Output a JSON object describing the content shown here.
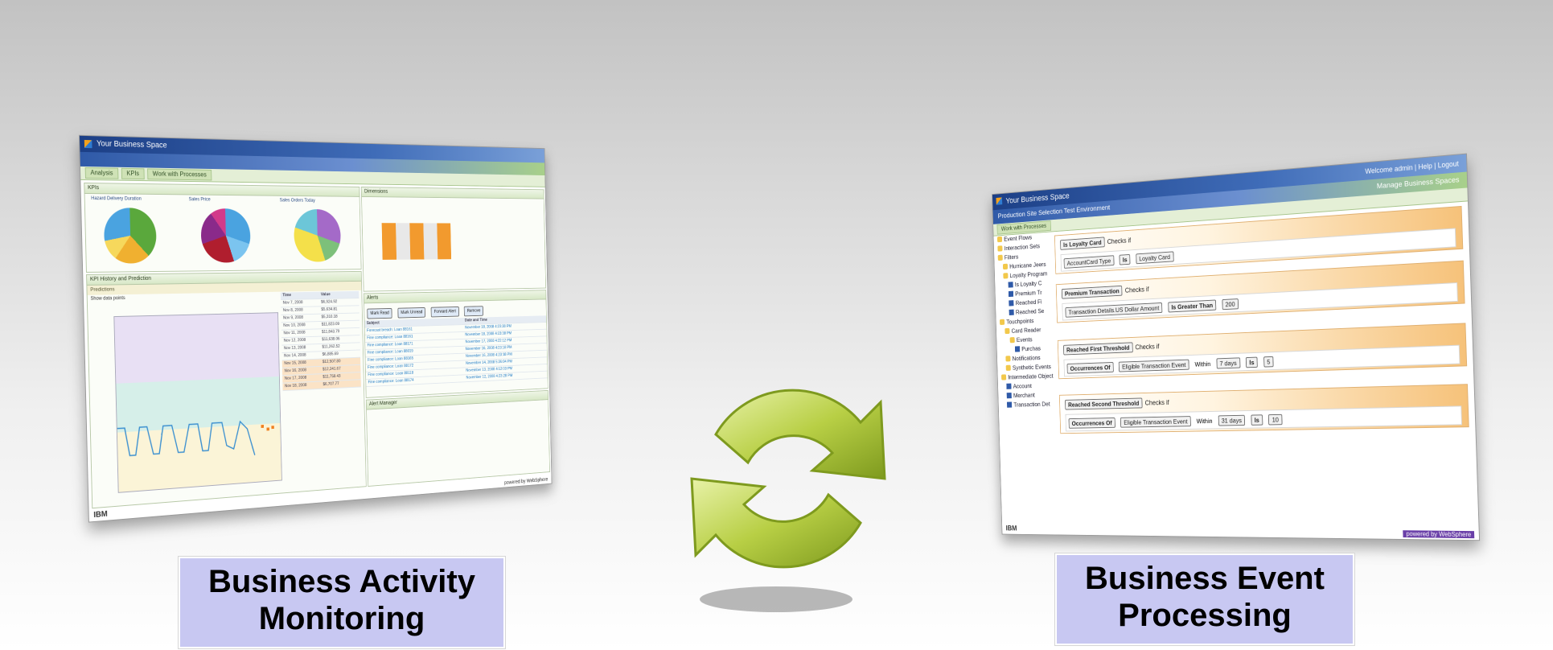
{
  "captions": {
    "bam_line1": "Business Activity",
    "bam_line2": "Monitoring",
    "bep_line1": "Business Event",
    "bep_line2": "Processing"
  },
  "left_screen": {
    "app_title": "Your Business Space",
    "tabs": [
      "Analysis",
      "KPIs",
      "Work with Processes"
    ],
    "kpi_panel_title": "KPIs",
    "pie_titles": [
      "Hazard Delivery Duration",
      "Sales Price",
      "Sales Orders Today"
    ],
    "kpi_history_title": "KPI History and Prediction",
    "kpi_history_tab": "Predictions",
    "show_data_points_label": "Show data points",
    "y_axis_values": [
      "$20,000",
      "$19,000",
      "$18,000",
      "$17,000",
      "$16,000",
      "$15,000",
      "$14,000",
      "$13,000",
      "$12,000",
      "$11,000",
      "$10,000",
      "$9,000",
      "$8,000",
      "$7,000",
      "$6,000",
      "$5,000"
    ],
    "x_axis_values": [
      "Nov 1, 2008",
      "Nov 7, 2008",
      "Nov 14, 2008",
      "Nov 21, 2008",
      "Nov 28, 2008",
      "Dec 5, 2008",
      "Nov 7, 2008"
    ],
    "table_header": [
      "Time",
      "Value"
    ],
    "table_rows": [
      [
        "Nov 7, 2008",
        "$6,924.92"
      ],
      [
        "Nov 8, 2008",
        "$5,634.81"
      ],
      [
        "Nov 9, 2008",
        "$5,310.18"
      ],
      [
        "Nov 10, 2008",
        "$11,823.09"
      ],
      [
        "Nov 11, 2008",
        "$11,843.79"
      ],
      [
        "Nov 12, 2008",
        "$11,638.06"
      ],
      [
        "Nov 13, 2008",
        "$11,262.52"
      ],
      [
        "Nov 14, 2008",
        "$6,885.69"
      ],
      [
        "Nov 15, 2008",
        "$12,507.80"
      ],
      [
        "Nov 16, 2008",
        "$12,241.67"
      ],
      [
        "Nov 17, 2008",
        "$11,758.43"
      ],
      [
        "Nov 18, 2008",
        "$6,707.77"
      ]
    ],
    "dimensions_title": "Dimensions",
    "alerts_title": "Alerts",
    "alert_buttons": [
      "Mark Read",
      "Mark Unread",
      "Forward Alert",
      "Remove"
    ],
    "alert_cols": [
      "Subject",
      "Date and Time"
    ],
    "alert_rows": [
      [
        "Forecast breach: Loan 88161",
        "November 18, 2008 4:23:38 PM"
      ],
      [
        "Fine compliance: Loan 88161",
        "November 18, 2008 4:23:38 PM"
      ],
      [
        "Fine compliance: Loan 88171",
        "November 17, 2008 4:22:12 PM"
      ],
      [
        "Fine compliance: Loan 88019",
        "November 16, 2008 4:23:18 PM"
      ],
      [
        "Fine compliance: Loan 88165",
        "November 16, 2008 4:23:18 PM"
      ],
      [
        "Fine compliance: Loan 88172",
        "November 14, 2008 5:36:04 PM"
      ],
      [
        "Fine compliance: Loan 88118",
        "November 13, 2008 4:12:03 PM"
      ],
      [
        "Fine compliance: Loan 88174",
        "November 12, 2008 4:23:28 PM"
      ]
    ],
    "alert_manager_title": "Alert Manager",
    "footer_brand": "IBM",
    "powered_by": "powered by WebSphere"
  },
  "right_screen": {
    "app_title": "Your Business Space",
    "environment": "Production Site Selection Test Environment",
    "banner_link": "Manage Business Spaces",
    "header_links": [
      "Welcome admin",
      "Help",
      "Logout"
    ],
    "tab": "Work with Processes",
    "tree": [
      "Event Flows",
      "Interaction Sets",
      "Filters",
      "Hurricane Jeers",
      "Loyalty Program",
      "Is Loyalty C",
      "Premium Tr",
      "Reached Fi",
      "Reached Se",
      "Touchpoints",
      "Card Reader",
      "Events",
      "Purchas",
      "Notifications",
      "Synthetic Events",
      "Intermediate Object",
      "Account",
      "Merchant",
      "Transaction Det"
    ],
    "rules": [
      {
        "name": "Is Loyalty Card",
        "checks": "Checks if",
        "body": [
          "AccountCard Type",
          "Is",
          "Loyalty Card"
        ]
      },
      {
        "name": "Premium Transaction",
        "checks": "Checks if",
        "body": [
          "Transaction Details.US Dollar Amount",
          "Is Greater Than",
          "200"
        ]
      },
      {
        "name": "Reached First Threshold",
        "checks": "Checks if",
        "body": [
          "Occurrences Of",
          "Eligible Transaction Event",
          "Within",
          "7 days",
          "Is",
          "5"
        ]
      },
      {
        "name": "Reached Second Threshold",
        "checks": "Checks if",
        "body": [
          "Occurrences Of",
          "Eligible Transaction Event",
          "Within",
          "31 days",
          "Is",
          "10"
        ]
      }
    ],
    "footer_brand": "IBM",
    "powered_by": "powered by WebSphere"
  },
  "colors": {
    "caption_bg": "#c8c8f2",
    "arrow_green": "#a8c43a",
    "rule_orange": "#f6c27a"
  },
  "icons": [
    "cycle-arrows-icon",
    "folder-icon",
    "document-icon"
  ]
}
